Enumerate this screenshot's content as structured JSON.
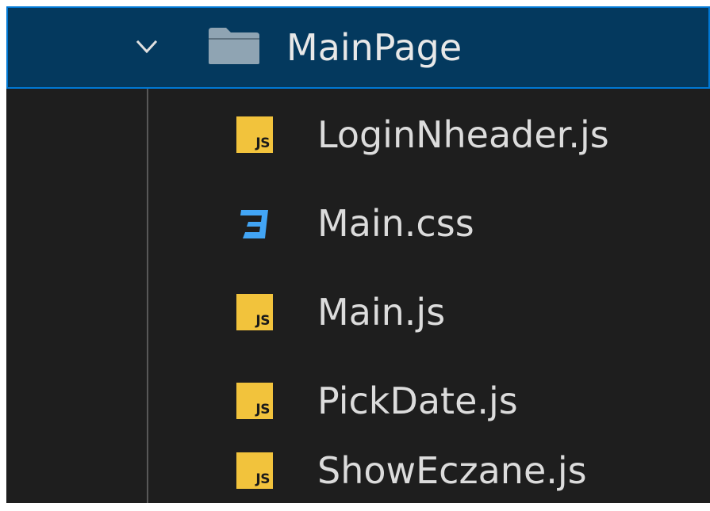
{
  "folder": {
    "name": "MainPage",
    "expanded": true,
    "chevron_icon": "chevron-down-icon",
    "folder_icon": "folder-open-icon"
  },
  "files": [
    {
      "name": "LoginNheader.js",
      "type": "js",
      "badge": "JS",
      "icon": "javascript-icon"
    },
    {
      "name": "Main.css",
      "type": "css",
      "icon": "css3-icon"
    },
    {
      "name": "Main.js",
      "type": "js",
      "badge": "JS",
      "icon": "javascript-icon"
    },
    {
      "name": "PickDate.js",
      "type": "js",
      "badge": "JS",
      "icon": "javascript-icon"
    },
    {
      "name": "ShowEczane.js",
      "type": "js",
      "badge": "JS",
      "icon": "javascript-icon"
    }
  ],
  "colors": {
    "background": "#1e1e1e",
    "selection_background": "#04395e",
    "selection_border": "#0078d4",
    "js_icon": "#f2c33c",
    "css_icon": "#42a5f5",
    "folder_icon": "#8fa4b3"
  }
}
